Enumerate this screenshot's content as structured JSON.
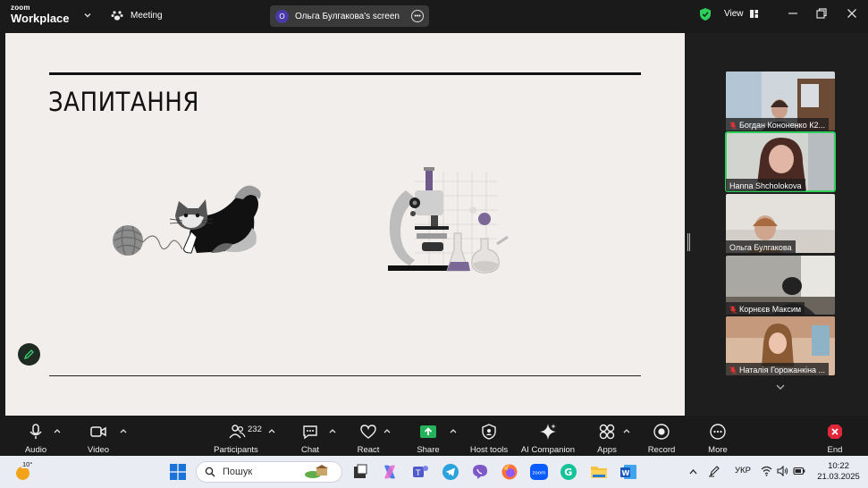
{
  "app": {
    "brand_top": "zoom",
    "brand_bottom": "Workplace",
    "meeting_label": "Meeting",
    "share_avatar_initial": "О",
    "share_label": "Ольга Булгакова's screen",
    "view_label": "View",
    "accent_green": "#2fcf5c"
  },
  "slide": {
    "title": "ЗАПИТАННЯ"
  },
  "participants_panel": {
    "tiles": [
      {
        "name": "Богдан Кононенко К2...",
        "muted": true
      },
      {
        "name": "Hanna Shcholokova",
        "muted": false,
        "active": true
      },
      {
        "name": "Ольга Булгакова",
        "muted": false
      },
      {
        "name": "Корнєєв Максим",
        "muted": true
      },
      {
        "name": "Наталія Горожанкіна ...",
        "muted": true
      }
    ]
  },
  "toolbar": {
    "audio": "Audio",
    "video": "Video",
    "participants": "Participants",
    "participants_count": "232",
    "chat": "Chat",
    "react": "React",
    "share": "Share",
    "host_tools": "Host tools",
    "ai_companion": "AI Companion",
    "apps": "Apps",
    "record": "Record",
    "more": "More",
    "end": "End",
    "end_color": "#e0283a",
    "share_color": "#24b35a"
  },
  "taskbar": {
    "weather_temp": "10°",
    "search_placeholder": "Пошук",
    "language": "УКР",
    "time": "10:22",
    "date": "21.03.2025"
  }
}
